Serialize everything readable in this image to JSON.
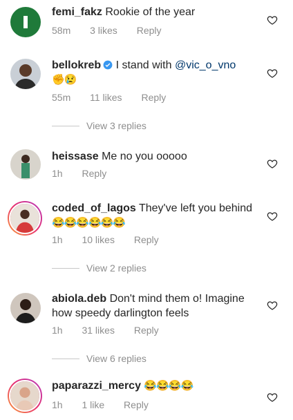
{
  "comments": [
    {
      "username": "femi_fakz",
      "text": "Rookie of the year",
      "time": "58m",
      "likes": "3 likes",
      "reply": "Reply"
    },
    {
      "username": "bellokreb",
      "text": "I stand with ",
      "mention": "@vic_o_vno",
      "emoji": "✊😢",
      "time": "55m",
      "likes": "11 likes",
      "reply": "Reply",
      "view_replies": "View 3 replies"
    },
    {
      "username": "heissase",
      "text": "Me no you ooooo",
      "time": "1h",
      "reply": "Reply"
    },
    {
      "username": "coded_of_lagos",
      "text": "They've left you behind",
      "emoji": "😂😂😂😂😂😂",
      "time": "1h",
      "likes": "10 likes",
      "reply": "Reply",
      "view_replies": "View 2 replies"
    },
    {
      "username": "abiola.deb",
      "text": "Don't mind them o! Imagine how speedy darlington feels",
      "time": "1h",
      "likes": "31 likes",
      "reply": "Reply",
      "view_replies": "View 6 replies"
    },
    {
      "username": "paparazzi_mercy",
      "text": "",
      "emoji": "😂😂😂😂",
      "time": "1h",
      "likes": "1 like",
      "reply": "Reply"
    }
  ],
  "colors": {
    "muted": "#8e8e8e",
    "link": "#00376b",
    "verified": "#3897f0"
  }
}
